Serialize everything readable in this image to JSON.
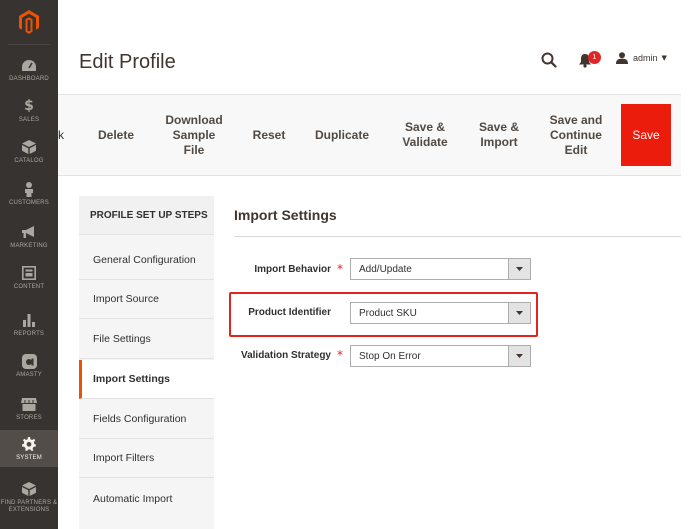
{
  "sidebar": {
    "items": [
      {
        "label": "DASHBOARD",
        "icon": "dashboard-icon"
      },
      {
        "label": "SALES",
        "icon": "dollar-icon"
      },
      {
        "label": "CATALOG",
        "icon": "box-icon"
      },
      {
        "label": "CUSTOMERS",
        "icon": "person-icon"
      },
      {
        "label": "MARKETING",
        "icon": "megaphone-icon"
      },
      {
        "label": "CONTENT",
        "icon": "content-icon"
      },
      {
        "label": "REPORTS",
        "icon": "bar-chart-icon"
      },
      {
        "label": "AMASTY",
        "icon": "amasty-icon"
      },
      {
        "label": "STORES",
        "icon": "store-icon"
      },
      {
        "label": "SYSTEM",
        "icon": "gear-icon"
      },
      {
        "label": "FIND PARTNERS & EXTENSIONS",
        "icon": "extensions-icon"
      }
    ],
    "active": "SYSTEM"
  },
  "header": {
    "title": "Edit Profile",
    "notification_count": "1",
    "user": "admin"
  },
  "toolbar": {
    "back_partial": "k",
    "buttons": [
      "Delete",
      "Download\nSample\nFile",
      "Reset",
      "Duplicate",
      "Save &\nValidate",
      "Save &\nImport",
      "Save and\nContinue\nEdit",
      "Save"
    ]
  },
  "steps": {
    "title": "PROFILE SET UP STEPS",
    "items": [
      "General Configuration",
      "Import Source",
      "File Settings",
      "Import Settings",
      "Fields Configuration",
      "Import Filters",
      "Automatic Import"
    ],
    "active": "Import Settings"
  },
  "section": {
    "title": "Import Settings",
    "fields": [
      {
        "label": "Import Behavior",
        "required": "*",
        "value": "Add/Update"
      },
      {
        "label": "Product Identifier",
        "required": "",
        "value": "Product SKU"
      },
      {
        "label": "Validation Strategy",
        "required": "*",
        "value": "Stop On Error"
      }
    ]
  },
  "colors": {
    "sidebar": "#373330",
    "accent": "#eb1c0b",
    "highlight": "#e0241f"
  }
}
